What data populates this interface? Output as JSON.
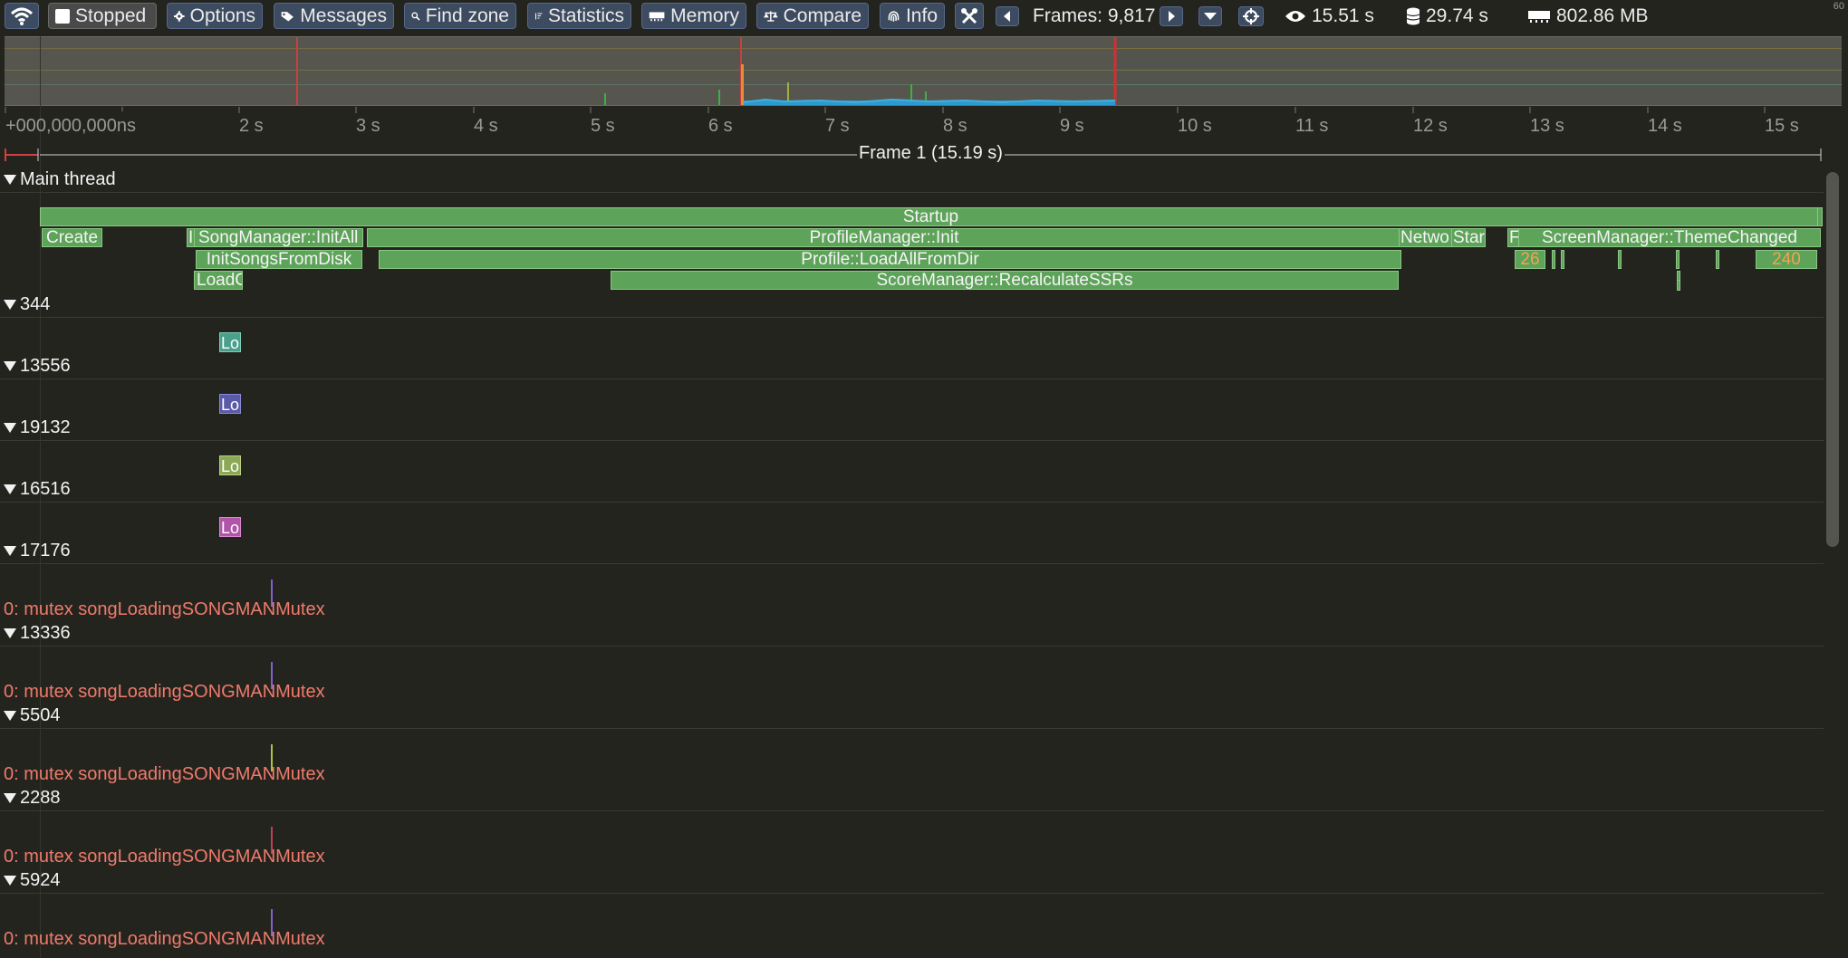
{
  "toolbar": {
    "stopped_label": "Stopped",
    "options_label": "Options",
    "messages_label": "Messages",
    "find_zone_label": "Find zone",
    "statistics_label": "Statistics",
    "memory_label": "Memory",
    "compare_label": "Compare",
    "info_label": "Info",
    "frames_text": "Frames: 9,817",
    "view_time": "15.51 s",
    "capture_time": "29.74 s",
    "memory_usage": "802.86 MB",
    "corner_value": "60"
  },
  "ruler": {
    "start_label": "+000,000,000ns",
    "tick_labels": [
      "2 s",
      "3 s",
      "4 s",
      "5 s",
      "6 s",
      "7 s",
      "8 s",
      "9 s",
      "10 s",
      "11 s",
      "12 s",
      "13 s",
      "14 s",
      "15 s"
    ]
  },
  "frame": {
    "label": "Frame 1 (15.19 s)"
  },
  "main_thread": {
    "name": "Main thread",
    "zones": {
      "startup": "Startup",
      "create": "Create",
      "i_fragment": "I",
      "songmanager_initall": "SongManager::InitAll",
      "profilemanager_init": "ProfileManager::Init",
      "network_fragment": "Netwo",
      "sta_fragment": "Star",
      "f_fragment": "F",
      "screenmanager_theme": "ScreenManager::ThemeChanged",
      "initsongs": "InitSongsFromDisk",
      "profile_loadall": "Profile::LoadAllFromDir",
      "num_26": "26",
      "num_240": "240",
      "loadc_fragment": "LoadC",
      "scoremanager_recalc": "ScoreManager::RecalculateSSRs"
    }
  },
  "threads": [
    {
      "name": "344",
      "zone": "Lo",
      "color": "#4aa08a"
    },
    {
      "name": "13556",
      "zone": "Lo",
      "color": "#5a5aa8"
    },
    {
      "name": "19132",
      "zone": "Lo",
      "color": "#8aa855"
    },
    {
      "name": "16516",
      "zone": "Lo",
      "color": "#b055a8"
    }
  ],
  "lock_threads": [
    {
      "name": "17176",
      "lock": "0: mutex songLoadingSONGMANMutex",
      "color": "#8060d0"
    },
    {
      "name": "13336",
      "lock": "0: mutex songLoadingSONGMANMutex",
      "color": "#8060d0"
    },
    {
      "name": "5504",
      "lock": "0: mutex songLoadingSONGMANMutex",
      "color": "#b0c040"
    },
    {
      "name": "2288",
      "lock": "0: mutex songLoadingSONGMANMutex",
      "color": "#c04050"
    },
    {
      "name": "5924",
      "lock": "0: mutex songLoadingSONGMANMutex",
      "color": "#8060d0"
    }
  ]
}
